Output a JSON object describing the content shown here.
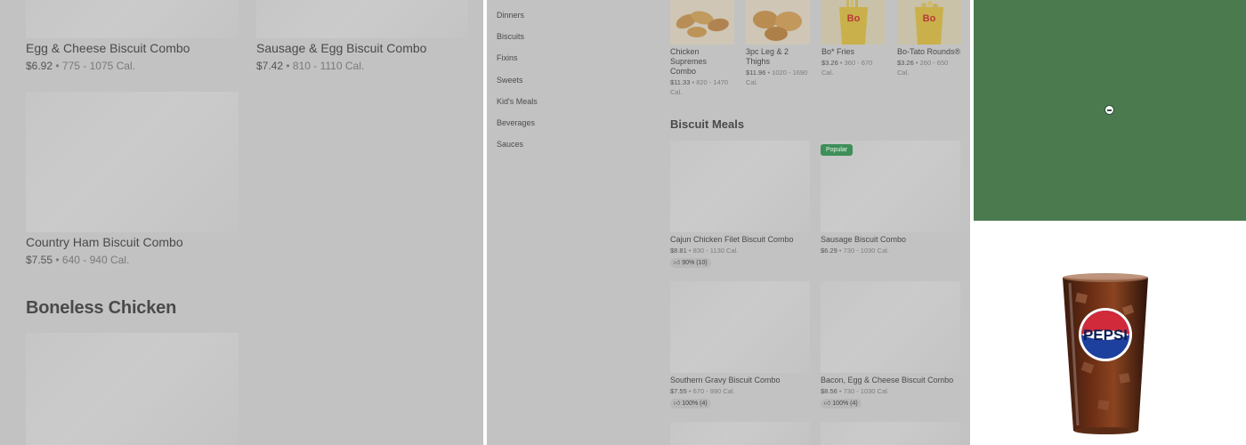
{
  "panel_left": {
    "items": [
      {
        "name": "Egg & Cheese Biscuit Combo",
        "price": "$6.92",
        "cal": "775 - 1075 Cal."
      },
      {
        "name": "Sausage & Egg Biscuit Combo",
        "price": "$7.42",
        "cal": "810 - 1110 Cal."
      },
      {
        "name": "Country Ham Biscuit Combo",
        "price": "$7.55",
        "cal": "640 - 940 Cal."
      }
    ],
    "separator": "•",
    "section_title": "Boneless Chicken"
  },
  "panel_middle": {
    "nav": [
      "Dinners",
      "Biscuits",
      "Fixins",
      "Sweets",
      "Kid's Meals",
      "Beverages",
      "Sauces"
    ],
    "top_items": [
      {
        "name": "Chicken Supremes Combo",
        "price": "$11.33",
        "cal": "820 - 1470 Cal."
      },
      {
        "name": "3pc Leg & 2 Thighs",
        "price": "$11.96",
        "cal": "1020 - 1690 Cal."
      },
      {
        "name": "Bo* Fries",
        "price": "$3.26",
        "cal": "360 - 670 Cal."
      },
      {
        "name": "Bo-Tato Rounds®",
        "price": "$3.26",
        "cal": "260 - 650 Cal."
      }
    ],
    "section_title": "Biscuit Meals",
    "popular_badge": "Popular",
    "meals": [
      {
        "name": "Cajun Chicken Filet Biscuit Combo",
        "price": "$8.81",
        "cal": "830 - 1130 Cal.",
        "rating": "90% (10)"
      },
      {
        "name": "Sausage Biscuit Combo",
        "price": "$6.29",
        "cal": "730 - 1030 Cal.",
        "rating": ""
      },
      {
        "name": "Southern Gravy Biscuit Combo",
        "price": "$7.55",
        "cal": "670 - 990 Cal.",
        "rating": "100% (4)"
      },
      {
        "name": "Bacon, Egg & Cheese Biscuit Combo",
        "price": "$8.56",
        "cal": "730 - 1030 Cal.",
        "rating": "100% (4)"
      }
    ]
  },
  "panel_right": {
    "cup_logo_text": "PEPSI",
    "bo_logo": "Bo",
    "green_hex": "#4a7a4e"
  },
  "icons": [
    "thumbs-up-icon",
    "minus-circle-icon"
  ]
}
